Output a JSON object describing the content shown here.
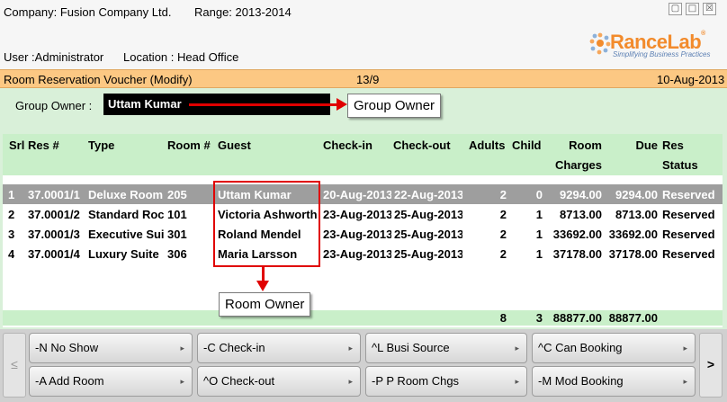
{
  "header": {
    "company": "Company: Fusion Company Ltd.",
    "range": "Range: 2013-2014",
    "user": "User :Administrator",
    "location": "Location : Head Office",
    "window_buttons": {
      "minimize": "▢",
      "maximize": "□",
      "close": "☒"
    }
  },
  "logo": {
    "name": "RanceLab",
    "registered": "®",
    "tagline": "Simplifying Business Practices",
    "color": "#f28b2c"
  },
  "voucher_bar": {
    "title": "Room Reservation Voucher (Modify)",
    "number": "13/9",
    "date": "10-Aug-2013",
    "color": "#fcc883"
  },
  "group_owner": {
    "label": "Group Owner :",
    "value": "Uttam Kumar"
  },
  "callouts": {
    "group_owner": "Group Owner",
    "room_owner": "Room Owner"
  },
  "table": {
    "headers": {
      "srl": "Srl",
      "res": "Res #",
      "type": "Type",
      "room": "Room #",
      "guest": "Guest",
      "checkin": "Check-in",
      "checkout": "Check-out",
      "adults": "Adults",
      "child": "Child",
      "charges_1": "Room",
      "charges_2": "Charges",
      "due": "Due",
      "status_1": "Res",
      "status_2": "Status"
    },
    "rows": [
      {
        "srl": "1",
        "res": "37.0001/1",
        "type": "Deluxe Room",
        "room": "205",
        "guest": "Uttam Kumar",
        "checkin": "20-Aug-2013",
        "checkout": "22-Aug-2013",
        "adults": "2",
        "child": "0",
        "charges": "9294.00",
        "due": "9294.00",
        "status": "Reserved"
      },
      {
        "srl": "2",
        "res": "37.0001/2",
        "type": "Standard Roc",
        "room": "101",
        "guest": "Victoria Ashworth",
        "checkin": "23-Aug-2013",
        "checkout": "25-Aug-2013",
        "adults": "2",
        "child": "1",
        "charges": "8713.00",
        "due": "8713.00",
        "status": "Reserved"
      },
      {
        "srl": "3",
        "res": "37.0001/3",
        "type": "Executive Sui",
        "room": "301",
        "guest": "Roland Mendel",
        "checkin": "23-Aug-2013",
        "checkout": "25-Aug-2013",
        "adults": "2",
        "child": "1",
        "charges": "33692.00",
        "due": "33692.00",
        "status": "Reserved"
      },
      {
        "srl": "4",
        "res": "37.0001/4",
        "type": "Luxury Suite",
        "room": "306",
        "guest": "Maria Larsson",
        "checkin": "23-Aug-2013",
        "checkout": "25-Aug-2013",
        "adults": "2",
        "child": "1",
        "charges": "37178.00",
        "due": "37178.00",
        "status": "Reserved"
      }
    ],
    "totals": {
      "adults": "8",
      "child": "3",
      "charges": "88877.00",
      "due": "88877.00"
    }
  },
  "buttons": {
    "prev": "≤",
    "next": ">",
    "no_show": "-N No Show",
    "check_in": "-C Check-in",
    "busi_source": "^L Busi Source",
    "can_booking": "^C Can Booking",
    "add_room": "-A Add Room",
    "check_out": "^O Check-out",
    "room_chgs": "-P P Room Chgs",
    "mod_booking": "-M Mod Booking",
    "arrow": "▸"
  }
}
